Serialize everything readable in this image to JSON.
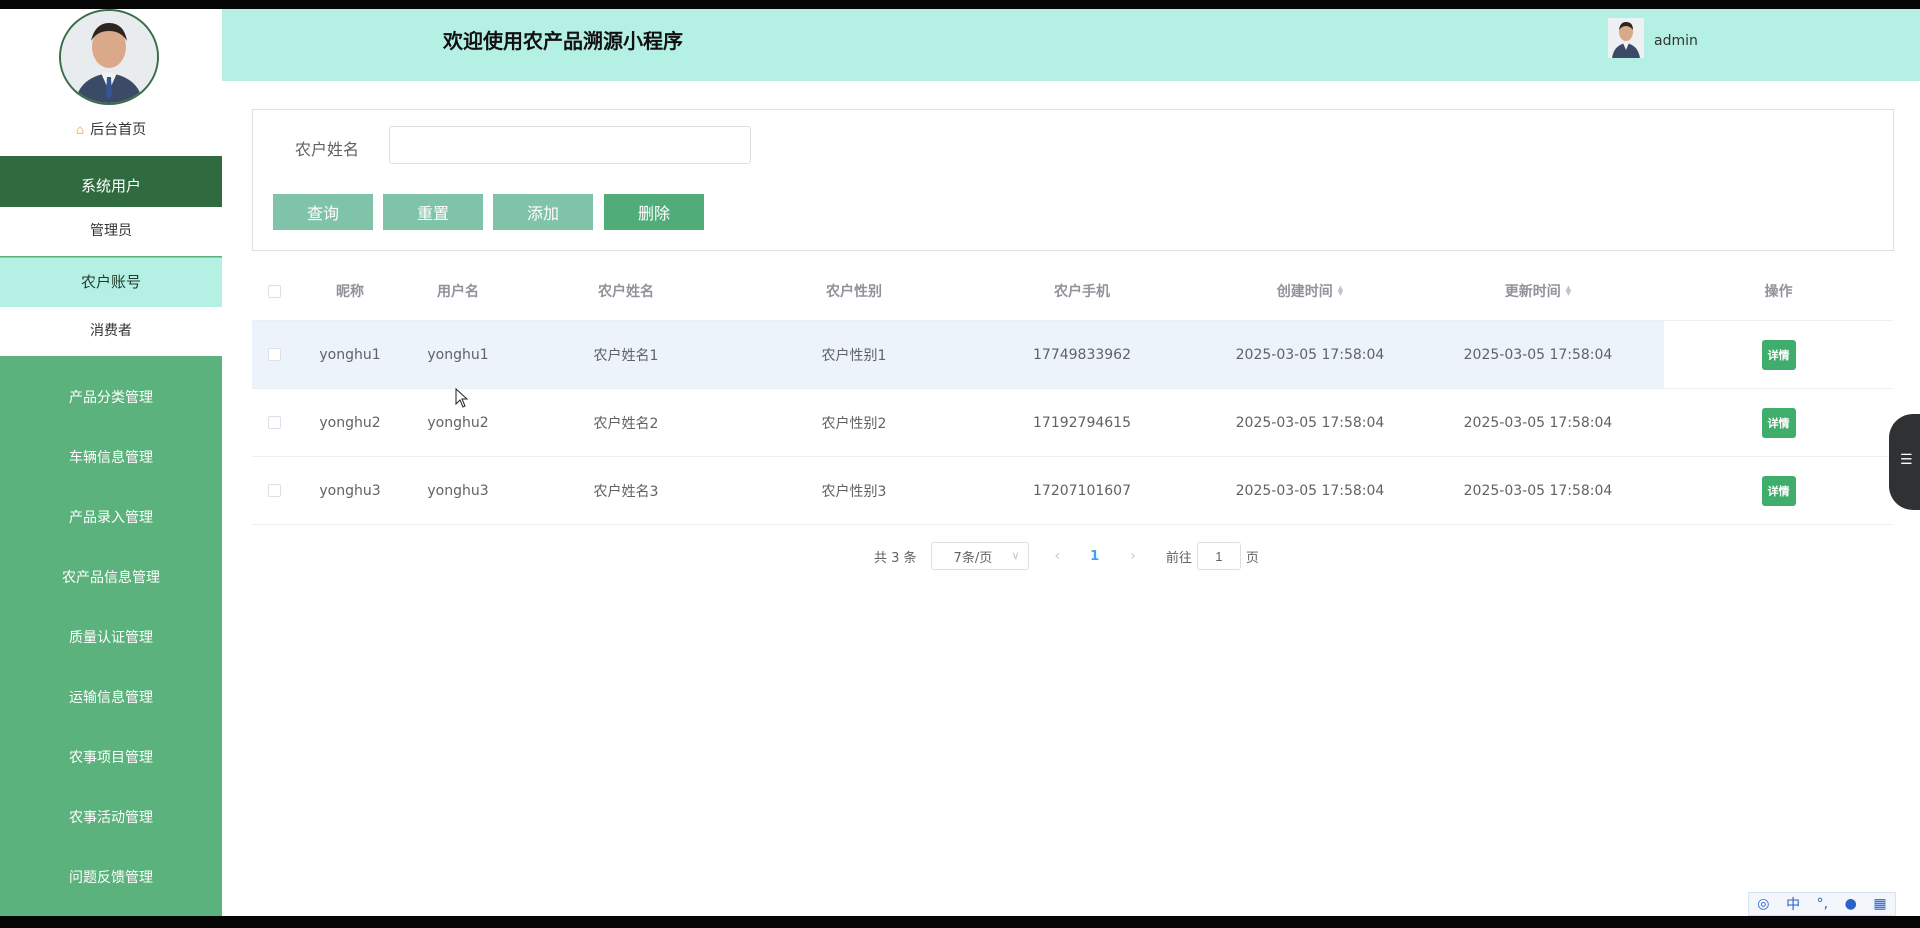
{
  "header": {
    "title": "欢迎使用农产品溯源小程序",
    "username": "admin"
  },
  "sidebar": {
    "home": "后台首页",
    "system_users": "系统用户",
    "sub_items": [
      "管理员",
      "农户账号",
      "消费者"
    ],
    "groups": [
      "产品分类管理",
      "车辆信息管理",
      "产品录入管理",
      "农产品信息管理",
      "质量认证管理",
      "运输信息管理",
      "农事项目管理",
      "农事活动管理",
      "问题反馈管理"
    ]
  },
  "search": {
    "label": "农户姓名",
    "value": "",
    "buttons": {
      "query": "查询",
      "reset": "重置",
      "add": "添加",
      "delete": "删除"
    }
  },
  "table": {
    "headers": [
      "昵称",
      "用户名",
      "农户姓名",
      "农户性别",
      "农户手机",
      "创建时间",
      "更新时间",
      "操作"
    ],
    "rows": [
      {
        "nickname": "yonghu1",
        "username": "yonghu1",
        "name": "农户姓名1",
        "gender": "农户性别1",
        "phone": "17749833962",
        "created": "2025-03-05 17:58:04",
        "updated": "2025-03-05 17:58:04",
        "action": "详情"
      },
      {
        "nickname": "yonghu2",
        "username": "yonghu2",
        "name": "农户姓名2",
        "gender": "农户性别2",
        "phone": "17192794615",
        "created": "2025-03-05 17:58:04",
        "updated": "2025-03-05 17:58:04",
        "action": "详情"
      },
      {
        "nickname": "yonghu3",
        "username": "yonghu3",
        "name": "农户姓名3",
        "gender": "农户性别3",
        "phone": "17207101607",
        "created": "2025-03-05 17:58:04",
        "updated": "2025-03-05 17:58:04",
        "action": "详情"
      }
    ]
  },
  "pagination": {
    "total": "共 3 条",
    "page_size": "7条/页",
    "current_page": "1",
    "goto_prefix": "前往",
    "goto_value": "1",
    "goto_suffix": "页"
  },
  "ime": {
    "lang": "中"
  }
}
